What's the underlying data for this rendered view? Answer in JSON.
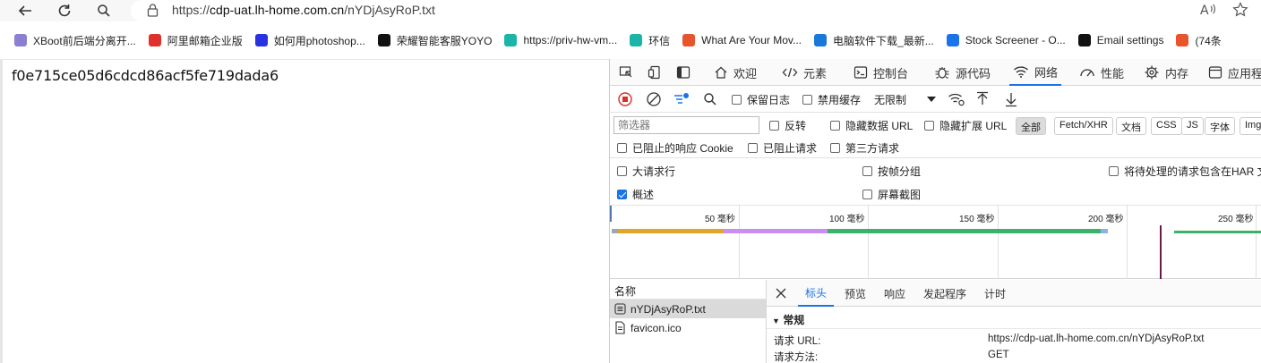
{
  "address_bar": {
    "url_prefix": "https://",
    "url_host": "cdp-uat.lh-home.com.cn",
    "url_path": "/nYDjAsyRoP.txt"
  },
  "bookmarks": [
    {
      "label": "XBoot前后端分离开...",
      "icon": "xboot-icon",
      "color": "#8a7fd1"
    },
    {
      "label": "阿里邮箱企业版",
      "icon": "alimail-icon",
      "color": "#e0302c"
    },
    {
      "label": "如何用photoshop...",
      "icon": "baidu-paw-icon",
      "color": "#2932e1"
    },
    {
      "label": "荣耀智能客服YOYO",
      "icon": "honor-icon",
      "color": "#111111"
    },
    {
      "label": "https://priv-hw-vm...",
      "icon": "cube-icon",
      "color": "#1bb5a7"
    },
    {
      "label": "环信",
      "icon": "huanxin-icon",
      "color": "#1bb5a7"
    },
    {
      "label": "What Are Your Mov...",
      "icon": "fire-icon",
      "color": "#e8542c"
    },
    {
      "label": "电脑软件下载_最新...",
      "icon": "download-site-icon",
      "color": "#1a78d6"
    },
    {
      "label": "Stock Screener - O...",
      "icon": "stock-icon",
      "color": "#1a73e8"
    },
    {
      "label": "Email settings",
      "icon": "github-icon",
      "color": "#111111"
    },
    {
      "label": "(74条",
      "icon": "c-icon",
      "color": "#e8542c"
    }
  ],
  "page": {
    "content": "f0e715ce05d6cdcd86acf5fe719dada6"
  },
  "devtools": {
    "tabs": [
      "欢迎",
      "元素",
      "控制台",
      "源代码",
      "网络",
      "性能",
      "内存",
      "应用程"
    ],
    "active_tab": "网络",
    "toolbar": {
      "preserve_log": "保留日志",
      "disable_cache": "禁用缓存",
      "throttle": "无限制"
    },
    "filter": {
      "placeholder": "筛选器",
      "invert": "反转",
      "hide_data_url": "隐藏数据 URL",
      "hide_ext_url": "隐藏扩展 URL",
      "types": [
        "全部",
        "Fetch/XHR",
        "文档",
        "CSS",
        "JS",
        "字体",
        "Img"
      ]
    },
    "row3": {
      "blocked_cookies": "已阻止的响应 Cookie",
      "blocked_requests": "已阻止请求",
      "third_party": "第三方请求"
    },
    "options": {
      "big_rows": "大请求行",
      "group_by_frame": "按帧分组",
      "har_sensitive": "将待处理的请求包含在HAR 文",
      "overview": "概述",
      "screenshots": "屏幕截图"
    },
    "timeline": {
      "ticks": [
        {
          "ms": 50,
          "label": "50 毫秒"
        },
        {
          "ms": 100,
          "label": "100 毫秒"
        },
        {
          "ms": 150,
          "label": "150 毫秒"
        },
        {
          "ms": 200,
          "label": "200 毫秒"
        },
        {
          "ms": 250,
          "label": "250 毫秒"
        }
      ]
    },
    "requests": {
      "header": "名称",
      "items": [
        "nYDjAsyRoP.txt",
        "favicon.ico"
      ]
    },
    "detail": {
      "tabs": [
        "标头",
        "预览",
        "响应",
        "发起程序",
        "计时"
      ],
      "section": "常规",
      "rows": [
        {
          "key": "请求 URL:",
          "value": "https://cdp-uat.lh-home.com.cn/nYDjAsyRoP.txt"
        },
        {
          "key": "请求方法:",
          "value": "GET"
        }
      ]
    }
  },
  "colors": {
    "accent": "#1a73e8",
    "timeline_wait": "#e0a62a",
    "timeline_ssl": "#c88ef0",
    "timeline_download": "#3bb26b",
    "timeline_marker": "#6a1a4a"
  }
}
